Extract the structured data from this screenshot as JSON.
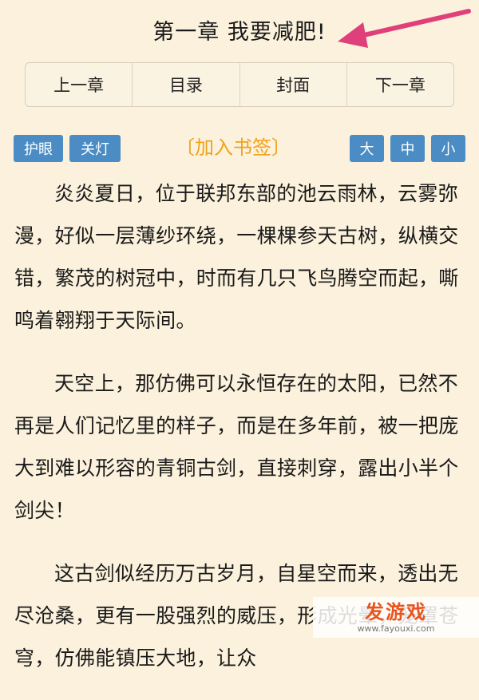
{
  "chapter_title": "第一章 我要减肥!",
  "nav": {
    "prev": "上一章",
    "toc": "目录",
    "cover": "封面",
    "next": "下一章"
  },
  "tools": {
    "eye_care": "护眼",
    "lights_off": "关灯",
    "bookmark": "〔加入书签〕",
    "size_large": "大",
    "size_medium": "中",
    "size_small": "小"
  },
  "paragraphs": [
    "炎炎夏日，位于联邦东部的池云雨林，云雾弥漫，好似一层薄纱环绕，一棵棵参天古树，纵横交错，繁茂的树冠中，时而有几只飞鸟腾空而起，嘶鸣着翱翔于天际间。",
    "天空上，那仿佛可以永恒存在的太阳，已然不再是人们记忆里的样子，而是在多年前，被一把庞大到难以形容的青铜古剑，直接刺穿，露出小半个剑尖！",
    "这古剑似经历万古岁月，自星空而来，透出无尽沧桑，更有一股强烈的威压，形成光晕，笼罩苍穹，仿佛能镇压大地，让众"
  ],
  "watermark": {
    "logo": "发游戏",
    "url": "www.fayouxi.com"
  },
  "colors": {
    "background": "#fbf1dc",
    "button_blue": "#4a8cc3",
    "bookmark_orange": "#f0a21a",
    "arrow_pink": "#e0407a"
  }
}
